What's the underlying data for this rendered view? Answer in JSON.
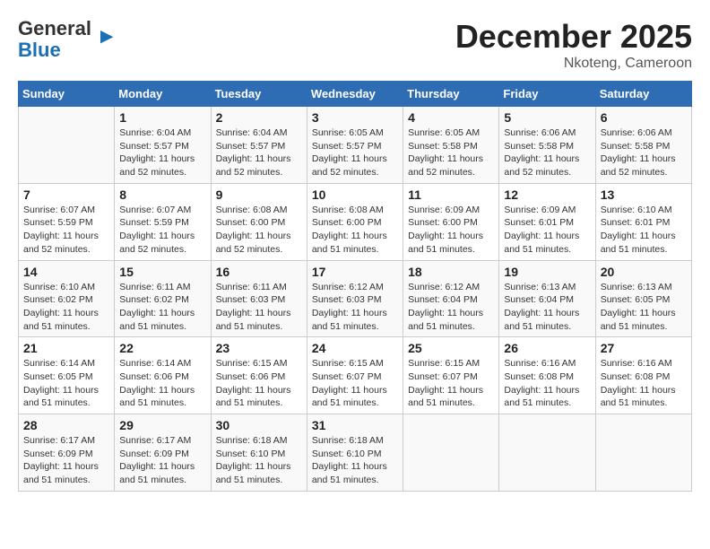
{
  "logo": {
    "general": "General",
    "blue": "Blue"
  },
  "title": "December 2025",
  "location": "Nkoteng, Cameroon",
  "days_header": [
    "Sunday",
    "Monday",
    "Tuesday",
    "Wednesday",
    "Thursday",
    "Friday",
    "Saturday"
  ],
  "weeks": [
    [
      {
        "day": "",
        "info": ""
      },
      {
        "day": "1",
        "info": "Sunrise: 6:04 AM\nSunset: 5:57 PM\nDaylight: 11 hours and 52 minutes."
      },
      {
        "day": "2",
        "info": "Sunrise: 6:04 AM\nSunset: 5:57 PM\nDaylight: 11 hours and 52 minutes."
      },
      {
        "day": "3",
        "info": "Sunrise: 6:05 AM\nSunset: 5:57 PM\nDaylight: 11 hours and 52 minutes."
      },
      {
        "day": "4",
        "info": "Sunrise: 6:05 AM\nSunset: 5:58 PM\nDaylight: 11 hours and 52 minutes."
      },
      {
        "day": "5",
        "info": "Sunrise: 6:06 AM\nSunset: 5:58 PM\nDaylight: 11 hours and 52 minutes."
      },
      {
        "day": "6",
        "info": "Sunrise: 6:06 AM\nSunset: 5:58 PM\nDaylight: 11 hours and 52 minutes."
      }
    ],
    [
      {
        "day": "7",
        "info": "Sunrise: 6:07 AM\nSunset: 5:59 PM\nDaylight: 11 hours and 52 minutes."
      },
      {
        "day": "8",
        "info": "Sunrise: 6:07 AM\nSunset: 5:59 PM\nDaylight: 11 hours and 52 minutes."
      },
      {
        "day": "9",
        "info": "Sunrise: 6:08 AM\nSunset: 6:00 PM\nDaylight: 11 hours and 52 minutes."
      },
      {
        "day": "10",
        "info": "Sunrise: 6:08 AM\nSunset: 6:00 PM\nDaylight: 11 hours and 51 minutes."
      },
      {
        "day": "11",
        "info": "Sunrise: 6:09 AM\nSunset: 6:00 PM\nDaylight: 11 hours and 51 minutes."
      },
      {
        "day": "12",
        "info": "Sunrise: 6:09 AM\nSunset: 6:01 PM\nDaylight: 11 hours and 51 minutes."
      },
      {
        "day": "13",
        "info": "Sunrise: 6:10 AM\nSunset: 6:01 PM\nDaylight: 11 hours and 51 minutes."
      }
    ],
    [
      {
        "day": "14",
        "info": "Sunrise: 6:10 AM\nSunset: 6:02 PM\nDaylight: 11 hours and 51 minutes."
      },
      {
        "day": "15",
        "info": "Sunrise: 6:11 AM\nSunset: 6:02 PM\nDaylight: 11 hours and 51 minutes."
      },
      {
        "day": "16",
        "info": "Sunrise: 6:11 AM\nSunset: 6:03 PM\nDaylight: 11 hours and 51 minutes."
      },
      {
        "day": "17",
        "info": "Sunrise: 6:12 AM\nSunset: 6:03 PM\nDaylight: 11 hours and 51 minutes."
      },
      {
        "day": "18",
        "info": "Sunrise: 6:12 AM\nSunset: 6:04 PM\nDaylight: 11 hours and 51 minutes."
      },
      {
        "day": "19",
        "info": "Sunrise: 6:13 AM\nSunset: 6:04 PM\nDaylight: 11 hours and 51 minutes."
      },
      {
        "day": "20",
        "info": "Sunrise: 6:13 AM\nSunset: 6:05 PM\nDaylight: 11 hours and 51 minutes."
      }
    ],
    [
      {
        "day": "21",
        "info": "Sunrise: 6:14 AM\nSunset: 6:05 PM\nDaylight: 11 hours and 51 minutes."
      },
      {
        "day": "22",
        "info": "Sunrise: 6:14 AM\nSunset: 6:06 PM\nDaylight: 11 hours and 51 minutes."
      },
      {
        "day": "23",
        "info": "Sunrise: 6:15 AM\nSunset: 6:06 PM\nDaylight: 11 hours and 51 minutes."
      },
      {
        "day": "24",
        "info": "Sunrise: 6:15 AM\nSunset: 6:07 PM\nDaylight: 11 hours and 51 minutes."
      },
      {
        "day": "25",
        "info": "Sunrise: 6:15 AM\nSunset: 6:07 PM\nDaylight: 11 hours and 51 minutes."
      },
      {
        "day": "26",
        "info": "Sunrise: 6:16 AM\nSunset: 6:08 PM\nDaylight: 11 hours and 51 minutes."
      },
      {
        "day": "27",
        "info": "Sunrise: 6:16 AM\nSunset: 6:08 PM\nDaylight: 11 hours and 51 minutes."
      }
    ],
    [
      {
        "day": "28",
        "info": "Sunrise: 6:17 AM\nSunset: 6:09 PM\nDaylight: 11 hours and 51 minutes."
      },
      {
        "day": "29",
        "info": "Sunrise: 6:17 AM\nSunset: 6:09 PM\nDaylight: 11 hours and 51 minutes."
      },
      {
        "day": "30",
        "info": "Sunrise: 6:18 AM\nSunset: 6:10 PM\nDaylight: 11 hours and 51 minutes."
      },
      {
        "day": "31",
        "info": "Sunrise: 6:18 AM\nSunset: 6:10 PM\nDaylight: 11 hours and 51 minutes."
      },
      {
        "day": "",
        "info": ""
      },
      {
        "day": "",
        "info": ""
      },
      {
        "day": "",
        "info": ""
      }
    ]
  ]
}
